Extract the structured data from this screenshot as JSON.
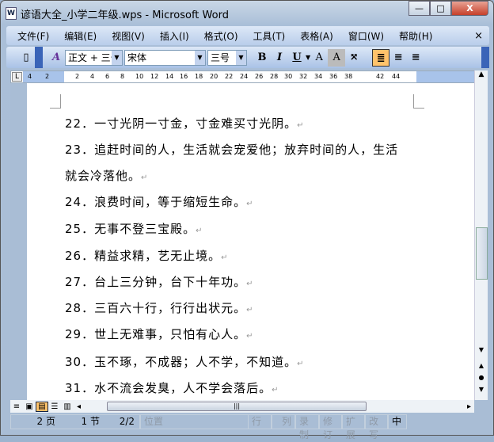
{
  "window": {
    "title": "谚语大全_小学二年级.wps - Microsoft Word",
    "app_icon": "W",
    "minimize": "—",
    "maximize": "□",
    "close": "X"
  },
  "menu": [
    "文件(F)",
    "编辑(E)",
    "视图(V)",
    "插入(I)",
    "格式(O)",
    "工具(T)",
    "表格(A)",
    "窗口(W)",
    "帮助(H)"
  ],
  "menu_close": "×",
  "toolbar": {
    "style": "正文 + 三号",
    "font": "宋体",
    "size": "三号",
    "bold": "B",
    "italic": "I",
    "underline": "U",
    "char_border": "A",
    "char_shading": "A",
    "style_icon": "A"
  },
  "ruler": [
    "4",
    "2",
    "2",
    "4",
    "6",
    "8",
    "10",
    "12",
    "14",
    "16",
    "18",
    "20",
    "22",
    "24",
    "26",
    "28",
    "30",
    "32",
    "34",
    "36",
    "38",
    "42",
    "44"
  ],
  "lines": [
    "22．一寸光阴一寸金，寸金难买寸光阴。",
    "23．追赶时间的人，生活就会宠爱他；放弃时间的人，生活",
    "就会冷落他。",
    "24．浪费时间，等于缩短生命。",
    "25．无事不登三宝殿。",
    "26．精益求精，艺无止境。",
    "27．台上三分钟，台下十年功。",
    "28．三百六十行，行行出状元。",
    "29．世上无难事，只怕有心人。",
    "30．玉不琢，不成器；人不学，不知道。",
    "31．水不流会发臭，人不学会落后。"
  ],
  "paragraph_mark": "↵",
  "status": {
    "page": "2 页",
    "section": "1 节",
    "pages": "2/2",
    "position": "位置",
    "line": "行",
    "col": "列",
    "rec": "录制",
    "trk": "修订",
    "ext": "扩展",
    "ovr": "改写",
    "lang": "中"
  }
}
